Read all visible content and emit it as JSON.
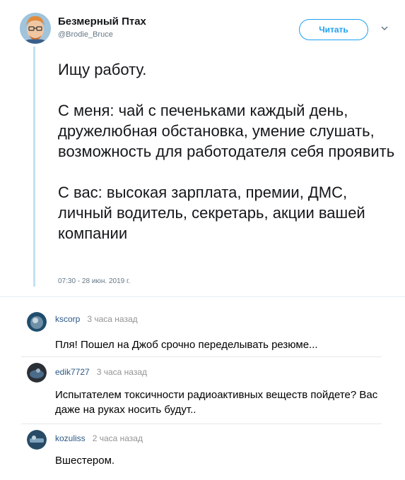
{
  "tweet": {
    "author_name": "Безмерный Птах",
    "author_handle": "@Brodie_Bruce",
    "follow_label": "Читать",
    "paragraphs": [
      "Ищу работу.",
      "С меня: чай с печеньками каждый день, дружелюбная обстановка, умение слушать, возможность для работодателя себя проявить",
      "С вас: высокая зарплата, премии, ДМС, личный водитель, секретарь, акции вашей компании"
    ],
    "timestamp": "07:30 - 28 июн. 2019 г."
  },
  "comments": [
    {
      "user": "kscorp",
      "time": "3 часа назад",
      "text": "Пля! Пошел на Джоб срочно переделывать резюме..."
    },
    {
      "user": "edik7727",
      "time": "3 часа назад",
      "text": "Испытателем токсичности радиоактивных веществ пойдете? Вас даже на руках носить будут.."
    },
    {
      "user": "kozuliss",
      "time": "2 часа назад",
      "text": "Вшестером."
    }
  ],
  "colors": {
    "accent": "#1da1f2",
    "thread_line": "#c4e0ef",
    "comment_user": "#2a5885"
  },
  "icons": {
    "caret": "chevron-down-icon"
  }
}
